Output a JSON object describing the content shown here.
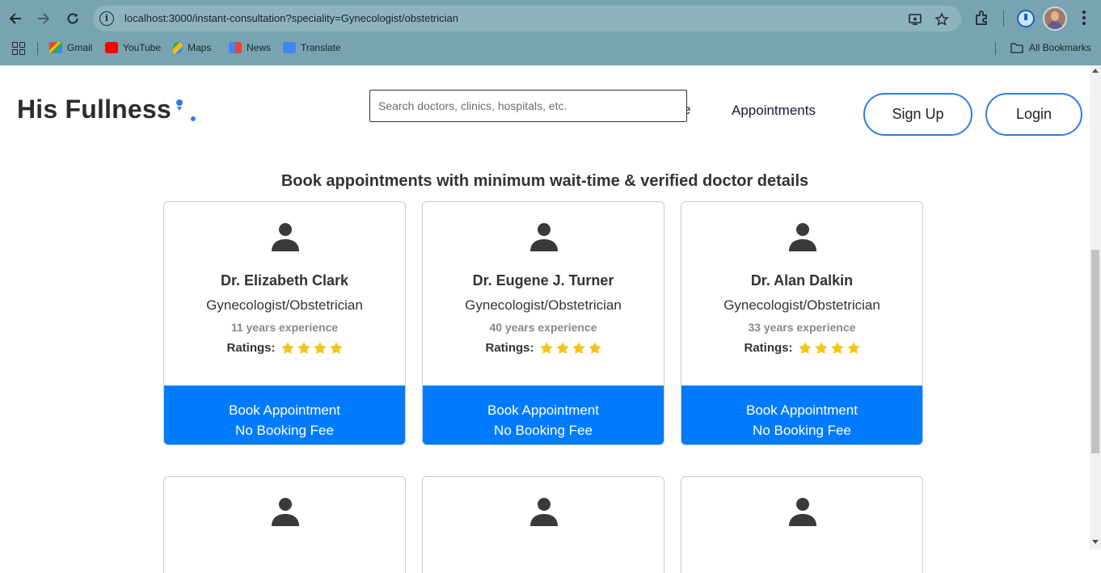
{
  "browser": {
    "url": "localhost:3000/instant-consultation?speciality=Gynecologist/obstetrician",
    "bookmarks": [
      {
        "label": "Gmail",
        "icon": "gmail-icon"
      },
      {
        "label": "YouTube",
        "icon": "youtube-icon"
      },
      {
        "label": "Maps",
        "icon": "maps-icon"
      },
      {
        "label": "News",
        "icon": "news-icon"
      },
      {
        "label": "Translate",
        "icon": "translate-icon"
      }
    ],
    "all_bookmarks": "All Bookmarks"
  },
  "header": {
    "brand": "His Fullness",
    "search_placeholder": "Search doctors, clinics, hospitals, etc.",
    "hidden_nav_fragment": "e",
    "nav_appointments": "Appointments",
    "signup_label": "Sign Up",
    "login_label": "Login"
  },
  "main": {
    "headline": "Book appointments with minimum wait-time & verified doctor details",
    "ratings_label": "Ratings:",
    "book_line1": "Book Appointment",
    "book_line2": "No Booking Fee",
    "doctors": [
      {
        "name": "Dr. Elizabeth Clark",
        "speciality": "Gynecologist/Obstetrician",
        "experience": "11 years experience",
        "stars": 4
      },
      {
        "name": "Dr. Eugene J. Turner",
        "speciality": "Gynecologist/Obstetrician",
        "experience": "40 years experience",
        "stars": 4
      },
      {
        "name": "Dr. Alan Dalkin",
        "speciality": "Gynecologist/Obstetrician",
        "experience": "33 years experience",
        "stars": 4
      }
    ]
  },
  "colors": {
    "accent": "#007bff",
    "outline": "#2d7de6",
    "star": "#f5c518",
    "chrome": "#78a4b2"
  }
}
